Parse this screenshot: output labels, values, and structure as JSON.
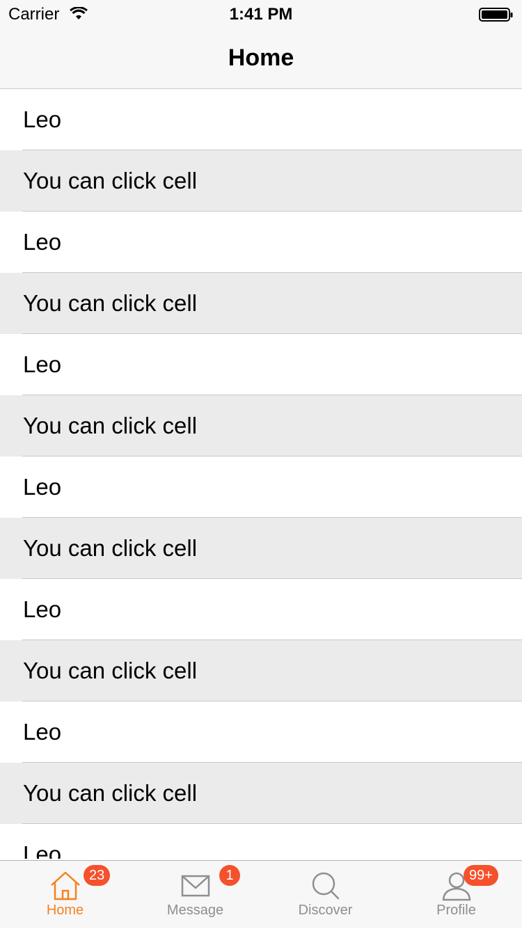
{
  "status_bar": {
    "carrier": "Carrier",
    "time": "1:41 PM"
  },
  "nav": {
    "title": "Home"
  },
  "cells": [
    {
      "label": "Leo"
    },
    {
      "label": "You can click cell"
    },
    {
      "label": "Leo"
    },
    {
      "label": "You can click cell"
    },
    {
      "label": "Leo"
    },
    {
      "label": "You can click cell"
    },
    {
      "label": "Leo"
    },
    {
      "label": "You can click cell"
    },
    {
      "label": "Leo"
    },
    {
      "label": "You can click cell"
    },
    {
      "label": "Leo"
    },
    {
      "label": "You can click cell"
    },
    {
      "label": "Leo"
    }
  ],
  "tabs": [
    {
      "label": "Home",
      "icon": "house-icon",
      "badge": "23",
      "active": true
    },
    {
      "label": "Message",
      "icon": "envelope-icon",
      "badge": "1",
      "active": false
    },
    {
      "label": "Discover",
      "icon": "magnifier-icon",
      "badge": "",
      "active": false
    },
    {
      "label": "Profile",
      "icon": "person-icon",
      "badge": "99+",
      "active": false
    }
  ],
  "colors": {
    "accent": "#f5821f",
    "badge": "#f4512c",
    "inactive": "#8e8e93",
    "cell_highlight": "#ebebeb"
  }
}
